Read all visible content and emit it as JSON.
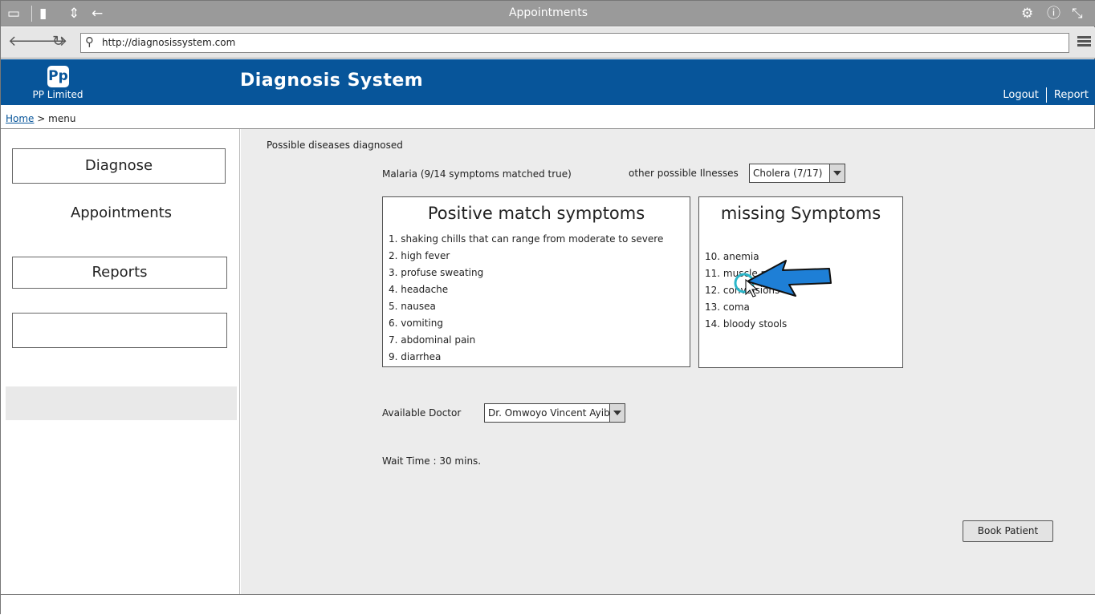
{
  "window": {
    "title": "Appointments"
  },
  "browser": {
    "url": "http://diagnosissystem.com"
  },
  "header": {
    "company": "PP Limited",
    "logo_text": "Pp",
    "app_title": "Diagnosis System",
    "links": [
      "Logout",
      "Report"
    ],
    "brand_color": "#07559a"
  },
  "breadcrumb": {
    "home": "Home",
    "separator": ">",
    "current": "menu"
  },
  "sidebar": {
    "items": [
      {
        "label": "Diagnose"
      },
      {
        "label": "Appointments"
      },
      {
        "label": "Reports"
      },
      {
        "label": ""
      }
    ]
  },
  "main": {
    "heading": "Possible diseases diagnosed",
    "primary_diagnosis": "Malaria (9/14 symptoms matched true)",
    "other_label": "other possible Ilnesses",
    "other_selected": "Cholera (7/17)",
    "positive_panel": {
      "title": "Positive match symptoms",
      "items": [
        "1. shaking chills that can range from moderate to severe",
        "2. high fever",
        "3. profuse sweating",
        "4. headache",
        "5. nausea",
        "6. vomiting",
        "7. abdominal pain",
        "9. diarrhea"
      ]
    },
    "missing_panel": {
      "title": "missing Symptoms",
      "items": [
        "10. anemia",
        "11. muscle pain",
        "12. convulsions",
        "13. coma",
        "14. bloody stools"
      ]
    },
    "doctor_label": "Available Doctor",
    "doctor_selected": "Dr. Omwoyo Vincent Ayib",
    "wait_time": "Wait Time : 30 mins.",
    "book_button": "Book Patient"
  }
}
